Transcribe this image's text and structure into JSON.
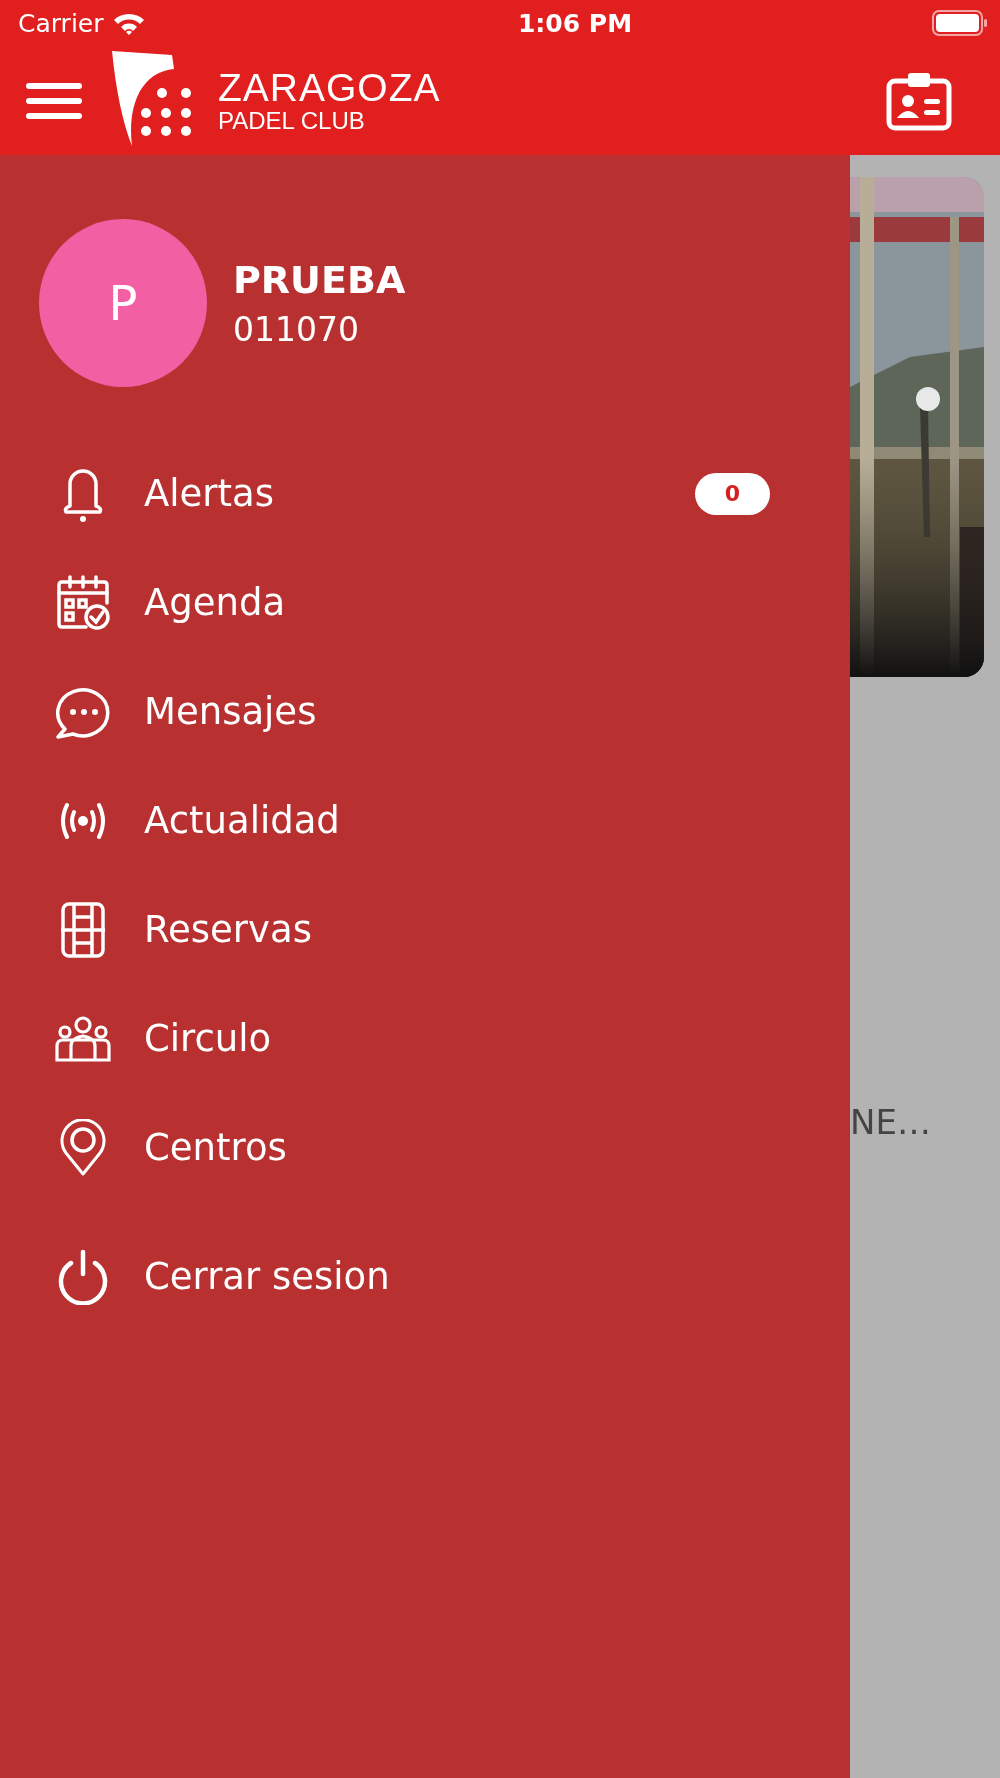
{
  "status_bar": {
    "carrier": "Carrier",
    "time": "1:06 PM"
  },
  "header": {
    "logo_title": "ZARAGOZA",
    "logo_subtitle": "PADEL CLUB"
  },
  "profile": {
    "initial": "P",
    "name": "PRUEBA",
    "member_id": "011070"
  },
  "menu": [
    {
      "kind": "bell",
      "label": "Alertas",
      "badge": "0"
    },
    {
      "kind": "calendar",
      "label": "Agenda"
    },
    {
      "kind": "chat",
      "label": "Mensajes"
    },
    {
      "kind": "broadcast",
      "label": "Actualidad"
    },
    {
      "kind": "court",
      "label": "Reservas"
    },
    {
      "kind": "group",
      "label": "Circulo"
    },
    {
      "kind": "pin",
      "label": "Centros"
    },
    {
      "kind": "power",
      "label": "Cerrar sesion"
    }
  ],
  "background": {
    "title": "NE…"
  }
}
